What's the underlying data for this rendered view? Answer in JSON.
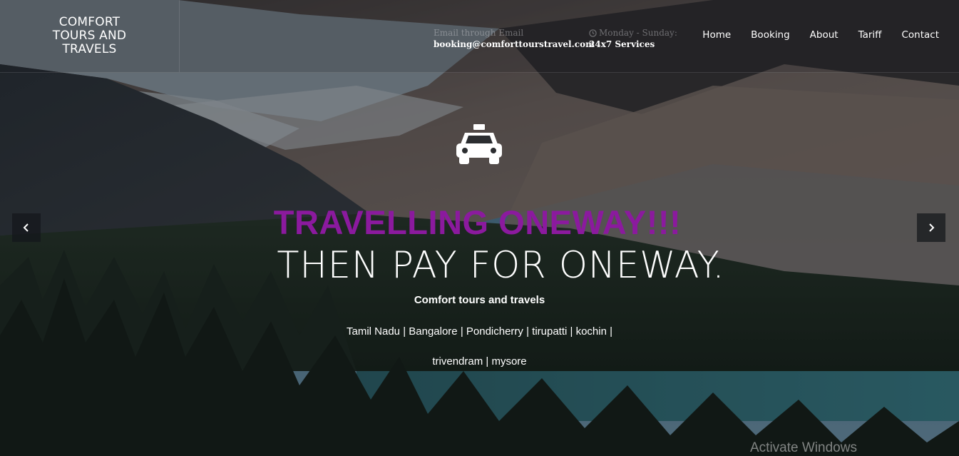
{
  "header": {
    "logo_text": "COMFORT TOURS AND TRAVELS",
    "email_label": "Email through Email",
    "email_value": "booking@comforttourstravel.com",
    "hours_label": "Monday - Sunday:",
    "hours_value": "24x7 Services",
    "hours_icon": "clock-icon"
  },
  "nav": {
    "items": [
      "Home",
      "Booking",
      "About",
      "Tariff",
      "Contact"
    ]
  },
  "hero": {
    "icon": "taxi-icon",
    "headline": "TRAVELLING ONEWAY!!!",
    "subheadline": "THEN PAY FOR ONEWAY.",
    "brand": "Comfort tours and travels",
    "cities_line1": "Tamil Nadu | Bangalore | Pondicherry | tirupatti | kochin |",
    "cities_line2": "trivendram | mysore",
    "prev_icon": "chevron-left-icon",
    "next_icon": "chevron-right-icon"
  },
  "watermark": "Activate Windows",
  "colors": {
    "headline": "#8b1a9e",
    "text": "#ffffff",
    "arrow_bg": "#14161a"
  }
}
